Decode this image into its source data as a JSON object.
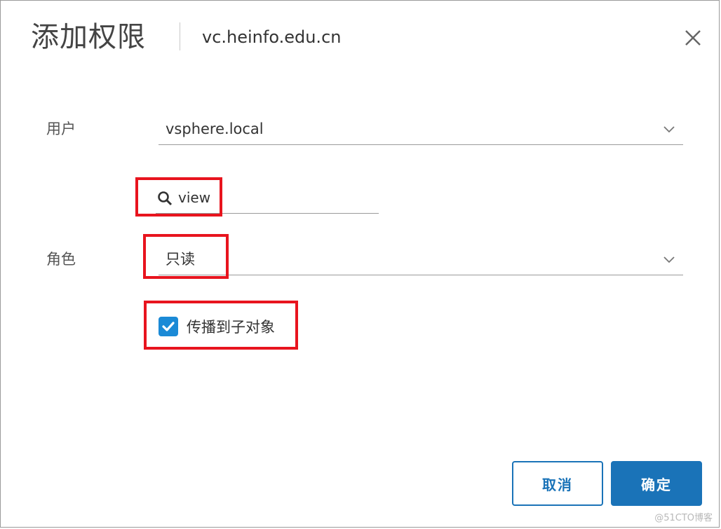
{
  "dialog": {
    "title": "添加权限",
    "subtitle": "vc.heinfo.edu.cn",
    "close_icon": "close-icon"
  },
  "user_field": {
    "label": "用户",
    "value": "vsphere.local"
  },
  "search": {
    "value": "view",
    "icon": "search-icon"
  },
  "role_field": {
    "label": "角色",
    "value": "只读"
  },
  "propagate": {
    "label": "传播到子对象",
    "checked": true
  },
  "buttons": {
    "cancel": "取消",
    "ok": "确定"
  },
  "colors": {
    "primary": "#1a73b8",
    "highlight": "#e8141e",
    "checkbox": "#1b8ad6"
  },
  "watermark": "@51CTO博客"
}
